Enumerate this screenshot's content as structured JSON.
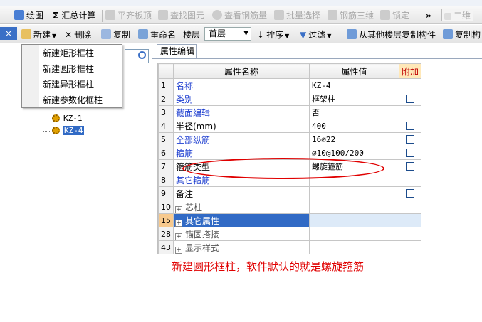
{
  "toolbar1": {
    "draw": "绘图",
    "sum": "汇总计算",
    "align_slab": "平齐板顶",
    "find": "查找图元",
    "view_rebar": "查看钢筋量",
    "batch_select": "批量选择",
    "rebar_3d": "钢筋三维",
    "lock": "锁定",
    "more": "»",
    "view_mode": "二维"
  },
  "toolbar2": {
    "new": "新建",
    "delete": "删除",
    "copy": "复制",
    "rename": "重命名",
    "floor_label": "楼层",
    "floor_value": "首层",
    "sort": "排序",
    "filter": "过滤",
    "copy_from_floor": "从其他楼层复制构件",
    "copy_to": "复制构"
  },
  "left_pane": {
    "close": "×",
    "tree_nodes": [
      "KZ-1",
      "KZ-4"
    ]
  },
  "new_menu": {
    "items": [
      "新建矩形框柱",
      "新建圆形框柱",
      "新建异形框柱",
      "新建参数化框柱"
    ]
  },
  "property_panel": {
    "tab": "属性编辑",
    "headers": {
      "name": "属性名称",
      "value": "属性值",
      "add": "附加"
    },
    "rows": [
      {
        "no": "1",
        "name": "名称",
        "value": "KZ-4",
        "check": false,
        "style": "blue"
      },
      {
        "no": "2",
        "name": "类别",
        "value": "框架柱",
        "check": true,
        "style": "blue"
      },
      {
        "no": "3",
        "name": "截面编辑",
        "value": "否",
        "check": false,
        "style": "blue"
      },
      {
        "no": "4",
        "name": "半径(mm)",
        "value": "400",
        "check": true,
        "style": "black"
      },
      {
        "no": "5",
        "name": "全部纵筋",
        "value": "16⌀22",
        "check": true,
        "style": "blue"
      },
      {
        "no": "6",
        "name": "箍筋",
        "value": "⌀10@100/200",
        "check": true,
        "style": "blue"
      },
      {
        "no": "7",
        "name": "箍筋类型",
        "value": "螺旋箍筋",
        "check": true,
        "style": "black"
      },
      {
        "no": "8",
        "name": "其它箍筋",
        "value": "",
        "check": false,
        "style": "blue"
      },
      {
        "no": "9",
        "name": "备注",
        "value": "",
        "check": true,
        "style": "black"
      },
      {
        "no": "10",
        "name": "芯柱",
        "value": "",
        "check": false,
        "style": "group"
      },
      {
        "no": "15",
        "name": "其它属性",
        "value": "",
        "check": false,
        "style": "group-selected"
      },
      {
        "no": "28",
        "name": "锚固搭接",
        "value": "",
        "check": false,
        "style": "group"
      },
      {
        "no": "43",
        "name": "显示样式",
        "value": "",
        "check": false,
        "style": "group"
      }
    ]
  },
  "annotation": "新建圆形框柱，软件默认的就是螺旋箍筋",
  "colors": {
    "annotation": "#e00000",
    "selection": "#316ac5",
    "link_text": "#1f3fd0"
  }
}
